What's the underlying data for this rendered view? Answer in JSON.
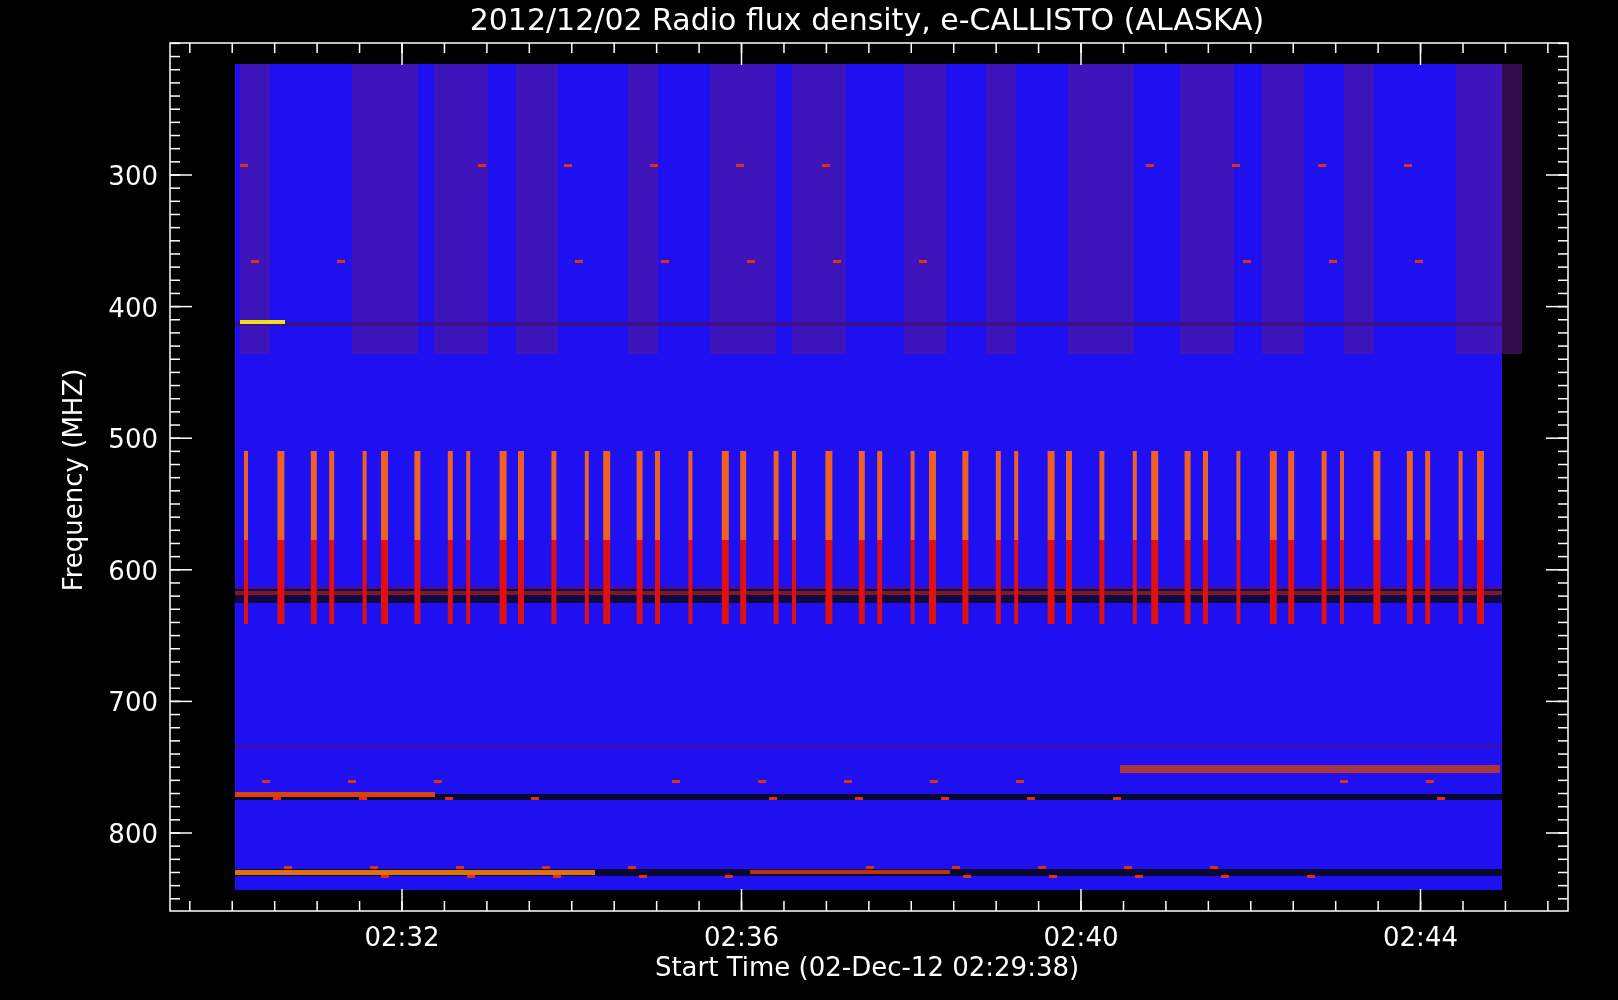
{
  "title": "2012/12/02  Radio flux density, e-CALLISTO (ALASKA)",
  "y_axis": {
    "label": "Frequency (MHZ)",
    "ticks": [
      "300",
      "400",
      "500",
      "600",
      "700",
      "800"
    ]
  },
  "x_axis": {
    "label": "Start Time (02-Dec-12 02:29:38)",
    "ticks": [
      "02:32",
      "02:36",
      "02:40",
      "02:44"
    ]
  }
}
